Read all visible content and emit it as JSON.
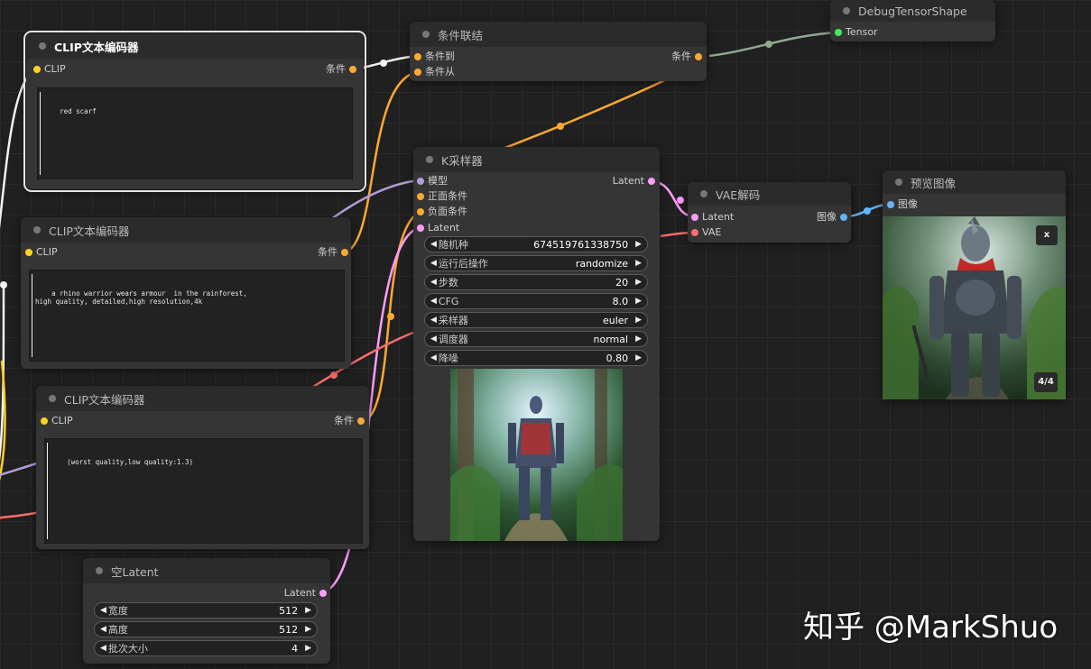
{
  "colors": {
    "clip": "#ffd21e",
    "conditioning": "#ffa931",
    "model": "#b39ddb",
    "latent": "#ff9cf9",
    "vae": "#ff6e6e",
    "image": "#64b5f6",
    "tensor": "#46e85e"
  },
  "nodes": {
    "clip1": {
      "title": "CLIP文本编码器",
      "in_clip": "CLIP",
      "out": "条件",
      "text": "red scarf"
    },
    "clip2": {
      "title": "CLIP文本编码器",
      "in_clip": "CLIP",
      "out": "条件",
      "text": "a rhino warrior wears armour  in the rainforest,\nhigh quality, detailed,high resolution,4k"
    },
    "clip3": {
      "title": "CLIP文本编码器",
      "in_clip": "CLIP",
      "out": "条件",
      "text": "(worst quality,low quality:1.3)"
    },
    "combine": {
      "title": "条件联结",
      "in1": "条件到",
      "in2": "条件从",
      "out": "条件"
    },
    "debug": {
      "title": "DebugTensorShape",
      "in1": "Tensor"
    },
    "ksampler": {
      "title": "K采样器",
      "in_model": "模型",
      "in_pos": "正面条件",
      "in_neg": "负面条件",
      "in_latent": "Latent",
      "out": "Latent",
      "widgets": [
        {
          "label": "随机种",
          "value": "674519761338750"
        },
        {
          "label": "运行后操作",
          "value": "randomize"
        },
        {
          "label": "步数",
          "value": "20"
        },
        {
          "label": "CFG",
          "value": "8.0"
        },
        {
          "label": "采样器",
          "value": "euler"
        },
        {
          "label": "调度器",
          "value": "normal"
        },
        {
          "label": "降噪",
          "value": "0.80"
        }
      ]
    },
    "vae": {
      "title": "VAE解码",
      "in1": "Latent",
      "in2": "VAE",
      "out": "图像"
    },
    "preview": {
      "title": "预览图像",
      "in1": "图像",
      "close": "x",
      "counter": "4/4"
    },
    "latent": {
      "title": "空Latent",
      "out": "Latent",
      "widgets": [
        {
          "label": "宽度",
          "value": "512"
        },
        {
          "label": "高度",
          "value": "512"
        },
        {
          "label": "批次大小",
          "value": "4"
        }
      ]
    }
  },
  "watermark": "知乎 @MarkShuo"
}
